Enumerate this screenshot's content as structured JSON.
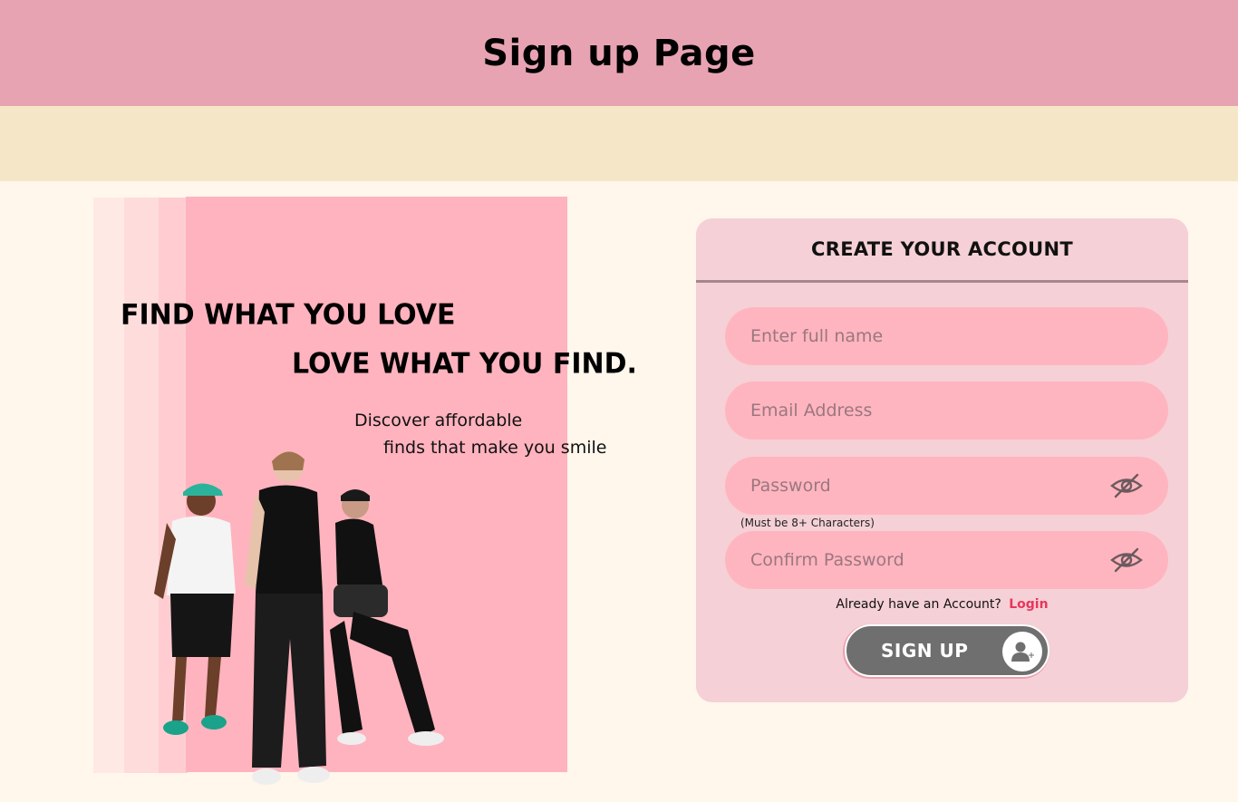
{
  "header": {
    "title": "Sign up Page"
  },
  "hero": {
    "slogan_line1": "FIND WHAT YOU LOVE",
    "slogan_line2": "LOVE WHAT YOU FIND.",
    "tagline_line1": "Discover affordable",
    "tagline_line2": "finds that make you smile"
  },
  "form": {
    "title": "CREATE YOUR ACCOUNT",
    "full_name_placeholder": "Enter full name",
    "email_placeholder": "Email Address",
    "password_placeholder": "Password",
    "password_hint": "(Must be 8+ Characters)",
    "confirm_placeholder": "Confirm Password",
    "have_account_text": "Already have an Account?",
    "login_label": "Login",
    "signup_label": "SIGN UP",
    "password_toggle_icon": "eye-slash-icon",
    "signup_icon": "user-plus-icon"
  },
  "colors": {
    "header_bg": "#e8a3b3",
    "band_bg": "#f6e6c8",
    "page_bg": "#fff6ec",
    "hero_panel": "#ffb3be",
    "card_bg": "#f5d0d6",
    "field_bg": "#ffb5bf",
    "login_link": "#e8365d",
    "signup_button": "#6f6f6f"
  }
}
